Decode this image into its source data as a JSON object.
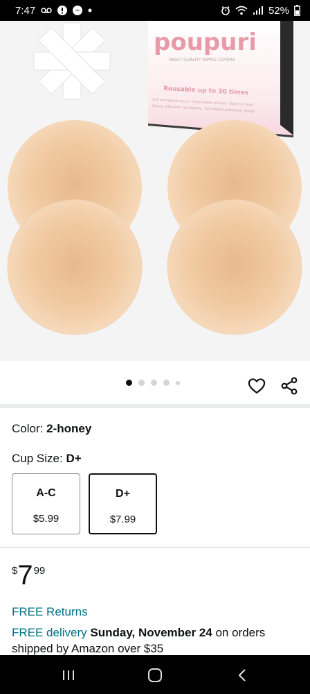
{
  "status_bar": {
    "time": "7:47",
    "battery": "52%",
    "left_icons": [
      "voicemail-icon",
      "alert-icon",
      "messenger-icon",
      "dot-icon"
    ],
    "right_icons": [
      "alarm-icon",
      "wifi-icon",
      "signal-icon",
      "battery-icon"
    ]
  },
  "product_image": {
    "brand_text": "poupuri",
    "box_subtitle": "HIGHT QUALITY NIPPLE COVERS",
    "box_tagline": "Reusable up to 30 times",
    "box_features_1": "Soft and gentle touch · Food-grade silicone · Easy to clean",
    "box_features_2": "Strong adhesion, no slipping · Anti-nipple protrusion design"
  },
  "carousel": {
    "dot_count": 5,
    "active_index": 0
  },
  "variations": {
    "color_label": "Color:",
    "color_value": "2-honey",
    "cup_label": "Cup Size:",
    "cup_value": "D+",
    "options": [
      {
        "name": "A-C",
        "price": "$5.99",
        "selected": false
      },
      {
        "name": "D+",
        "price": "$7.99",
        "selected": true
      }
    ]
  },
  "price": {
    "symbol": "$",
    "whole": "7",
    "fraction": "99"
  },
  "shipping": {
    "free_returns": "FREE Returns",
    "delivery_link": "FREE delivery",
    "delivery_date": "Sunday, November 24",
    "delivery_rest": "on orders shipped by Amazon over $35"
  },
  "colors": {
    "link": "#007185",
    "text": "#0f1111",
    "pad_skin": "#f2c99c"
  }
}
